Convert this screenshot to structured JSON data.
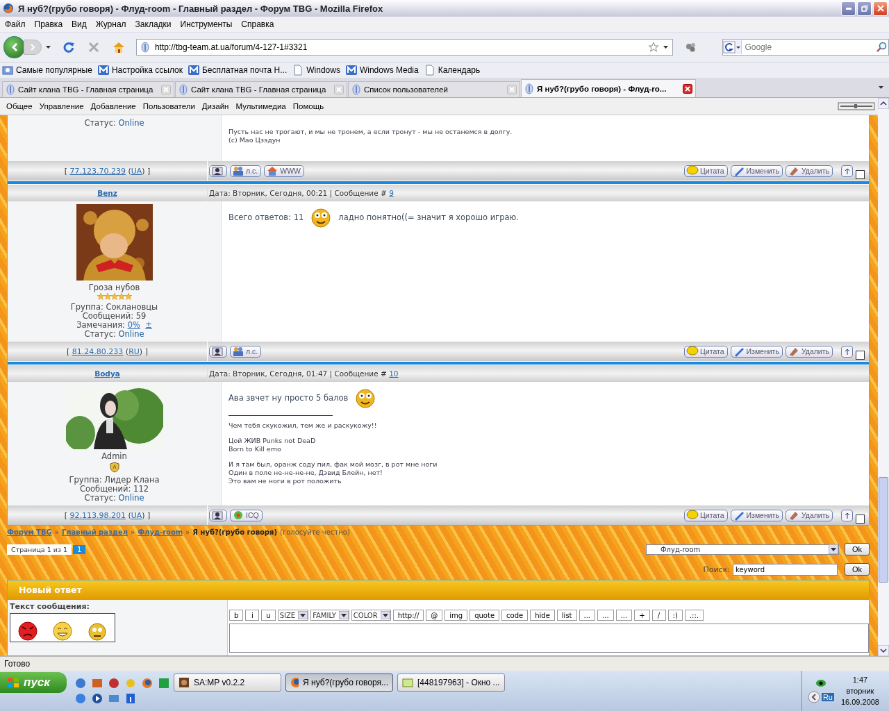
{
  "window": {
    "title": "Я нуб?(грубо говоря) - Флуд-room - Главный раздел - Форум TBG - Mozilla Firefox"
  },
  "menu": [
    "Файл",
    "Правка",
    "Вид",
    "Журнал",
    "Закладки",
    "Инструменты",
    "Справка"
  ],
  "address": {
    "url": "http://tbg-team.at.ua/forum/4-127-1#3321"
  },
  "search": {
    "placeholder": "Google"
  },
  "bookmarks": [
    {
      "label": "Самые популярные",
      "kind": "folder"
    },
    {
      "label": "Настройка ссылок",
      "kind": "msn"
    },
    {
      "label": "Бесплатная почта Н...",
      "kind": "msn"
    },
    {
      "label": "Windows",
      "kind": "page"
    },
    {
      "label": "Windows Media",
      "kind": "msn"
    },
    {
      "label": "Календарь",
      "kind": "page"
    }
  ],
  "tabs": [
    {
      "label": "Сайт клана TBG - Главная страница",
      "selected": false
    },
    {
      "label": "Сайт клана TBG - Главная страница",
      "selected": false
    },
    {
      "label": "Список пользователей",
      "selected": false
    },
    {
      "label": "Я нуб?(грубо говоря) - Флуд-ro...",
      "selected": true
    }
  ],
  "admin_menu": [
    "Общее",
    "Управление",
    "Добавление",
    "Пользователи",
    "Дизайн",
    "Мультимедиа",
    "Помощь"
  ],
  "previous_post": {
    "status_label": "Статус:",
    "status": "Online",
    "signature": [
      "Пусть нас не трогают, и мы не тронем, а если тронут - мы не останемся в долгу.",
      "(c) Мао Цзэдун"
    ],
    "ip_line": [
      {
        "kind": "text",
        "text": "[ "
      },
      {
        "kind": "link",
        "text": "77.123.70.239"
      },
      {
        "kind": "text",
        "text": " ("
      },
      {
        "kind": "link",
        "text": "UA"
      },
      {
        "kind": "text",
        "text": ")"
      },
      {
        "kind": "text",
        "text": " ]"
      }
    ],
    "contacts": [
      {
        "kind": "profile"
      },
      {
        "kind": "pm",
        "label": "л.с."
      },
      {
        "kind": "www",
        "label": "WWW"
      }
    ],
    "actions": [
      {
        "kind": "quote",
        "label": "Цитата"
      },
      {
        "kind": "edit",
        "label": "Изменить"
      },
      {
        "kind": "delete",
        "label": "Удалить"
      }
    ],
    "checked": false
  },
  "posts": [
    {
      "kind": "stars",
      "author": "Benz",
      "rank": "Гроза нубов",
      "stars": 5,
      "group": "Группа: Соклановцы",
      "messages": "Сообщений: 59",
      "remarks": {
        "label": "Замечания:",
        "value": "0%",
        "toggle": "±"
      },
      "status_label": "Статус:",
      "status": "Online",
      "date": "Дата: Вторник, Сегодня, 00:21 | Сообщение #",
      "number": "9",
      "body": [
        {
          "kind": "text",
          "text": "Всего ответов: 11"
        },
        {
          "kind": "smiley"
        },
        {
          "kind": "text",
          "text": "ладно понятно((= значит я хорошо играю."
        }
      ],
      "ip_line": [
        {
          "kind": "text",
          "text": "[ "
        },
        {
          "kind": "link",
          "text": "81.24.80.233"
        },
        {
          "kind": "text",
          "text": " ("
        },
        {
          "kind": "link",
          "text": "RU"
        },
        {
          "kind": "text",
          "text": ")"
        },
        {
          "kind": "text",
          "text": " ]"
        }
      ],
      "contacts": [
        {
          "kind": "profile"
        },
        {
          "kind": "pm",
          "label": "л.с."
        }
      ],
      "actions": [
        {
          "kind": "quote",
          "label": "Цитата"
        },
        {
          "kind": "edit",
          "label": "Изменить"
        },
        {
          "kind": "delete",
          "label": "Удалить"
        }
      ],
      "checked": false
    },
    {
      "kind": "badge",
      "author": "Bodya",
      "rank": "Admin",
      "group": "Группа: Лидер Клана",
      "messages": "Сообщений: 112",
      "status_label": "Статус:",
      "status": "Online",
      "date": "Дата: Вторник, Сегодня, 01:47 | Сообщение #",
      "number": "10",
      "body": [
        {
          "kind": "text",
          "text": "Ава звчет ну просто 5 балов"
        },
        {
          "kind": "smiley"
        }
      ],
      "signature": [
        [
          "Чем тебя скукожил, тем же и раскукожу!!"
        ],
        [
          "Цой ЖИВ Punks not DeaD",
          "Born to Kill emo"
        ],
        [
          "И я там был, оранж соду пил, фак мой мозг, в рот мне ноги",
          "Один в поле не-не-не-не, Дэвид Блейн, нет!",
          "Это вам не ноги в рот положить"
        ]
      ],
      "ip_line": [
        {
          "kind": "text",
          "text": "[ "
        },
        {
          "kind": "link",
          "text": "92.113.98.201"
        },
        {
          "kind": "text",
          "text": " ("
        },
        {
          "kind": "link",
          "text": "UA"
        },
        {
          "kind": "text",
          "text": ")"
        },
        {
          "kind": "text",
          "text": " ]"
        }
      ],
      "contacts": [
        {
          "kind": "profile"
        },
        {
          "kind": "icq",
          "label": "ICQ"
        }
      ],
      "actions": [
        {
          "kind": "quote",
          "label": "Цитата"
        },
        {
          "kind": "edit",
          "label": "Изменить"
        },
        {
          "kind": "delete",
          "label": "Удалить"
        }
      ],
      "checked": false
    }
  ],
  "breadcrumb": {
    "links": [
      "Форум TBG",
      "Главный раздел",
      "Флуд-room"
    ],
    "separator": "»",
    "title": "Я нуб?(грубо говоря)",
    "hint": "(голосуйте честно)"
  },
  "pager": {
    "label": "Страница 1 из 1",
    "pages": [
      {
        "label": "1",
        "selected": true
      }
    ]
  },
  "jump": {
    "value": "Флуд-room",
    "button": "Ok"
  },
  "forum_search": {
    "label": "Поиск:",
    "value": "keyword",
    "button": "Ok"
  },
  "reply": {
    "title": "Новый ответ",
    "message_label": "Текст сообщения:",
    "tools": [
      {
        "kind": "button",
        "label": "b"
      },
      {
        "kind": "button",
        "label": "i"
      },
      {
        "kind": "button",
        "label": "u"
      },
      {
        "kind": "select",
        "label": "SIZE"
      },
      {
        "kind": "select",
        "label": "FAMILY"
      },
      {
        "kind": "select",
        "label": "COLOR"
      },
      {
        "kind": "button",
        "label": "http://"
      },
      {
        "kind": "button",
        "label": "@"
      },
      {
        "kind": "button",
        "label": "img"
      },
      {
        "kind": "button",
        "label": "quote"
      },
      {
        "kind": "button",
        "label": "code"
      },
      {
        "kind": "button",
        "label": "hide"
      },
      {
        "kind": "button",
        "label": "list"
      },
      {
        "kind": "button",
        "label": "..."
      },
      {
        "kind": "button",
        "label": "..."
      },
      {
        "kind": "button",
        "label": "..."
      },
      {
        "kind": "button",
        "label": "+"
      },
      {
        "kind": "button",
        "label": "/"
      },
      {
        "kind": "button",
        "label": ":)"
      },
      {
        "kind": "button",
        "label": ".::."
      }
    ]
  },
  "status_bar": "Готово",
  "taskbar": {
    "start": "пуск",
    "tasks": [
      {
        "label": "SA:MP v0.2.2",
        "kind": "game",
        "selected": false
      },
      {
        "label": "Я нуб?(грубо говоря...",
        "kind": "firefox",
        "selected": true
      },
      {
        "label": "[448197963] - Окно ...",
        "kind": "chat",
        "selected": false
      }
    ],
    "language": "Ru",
    "time": "1:47",
    "day": "вторник",
    "date": "16.09.2008"
  }
}
